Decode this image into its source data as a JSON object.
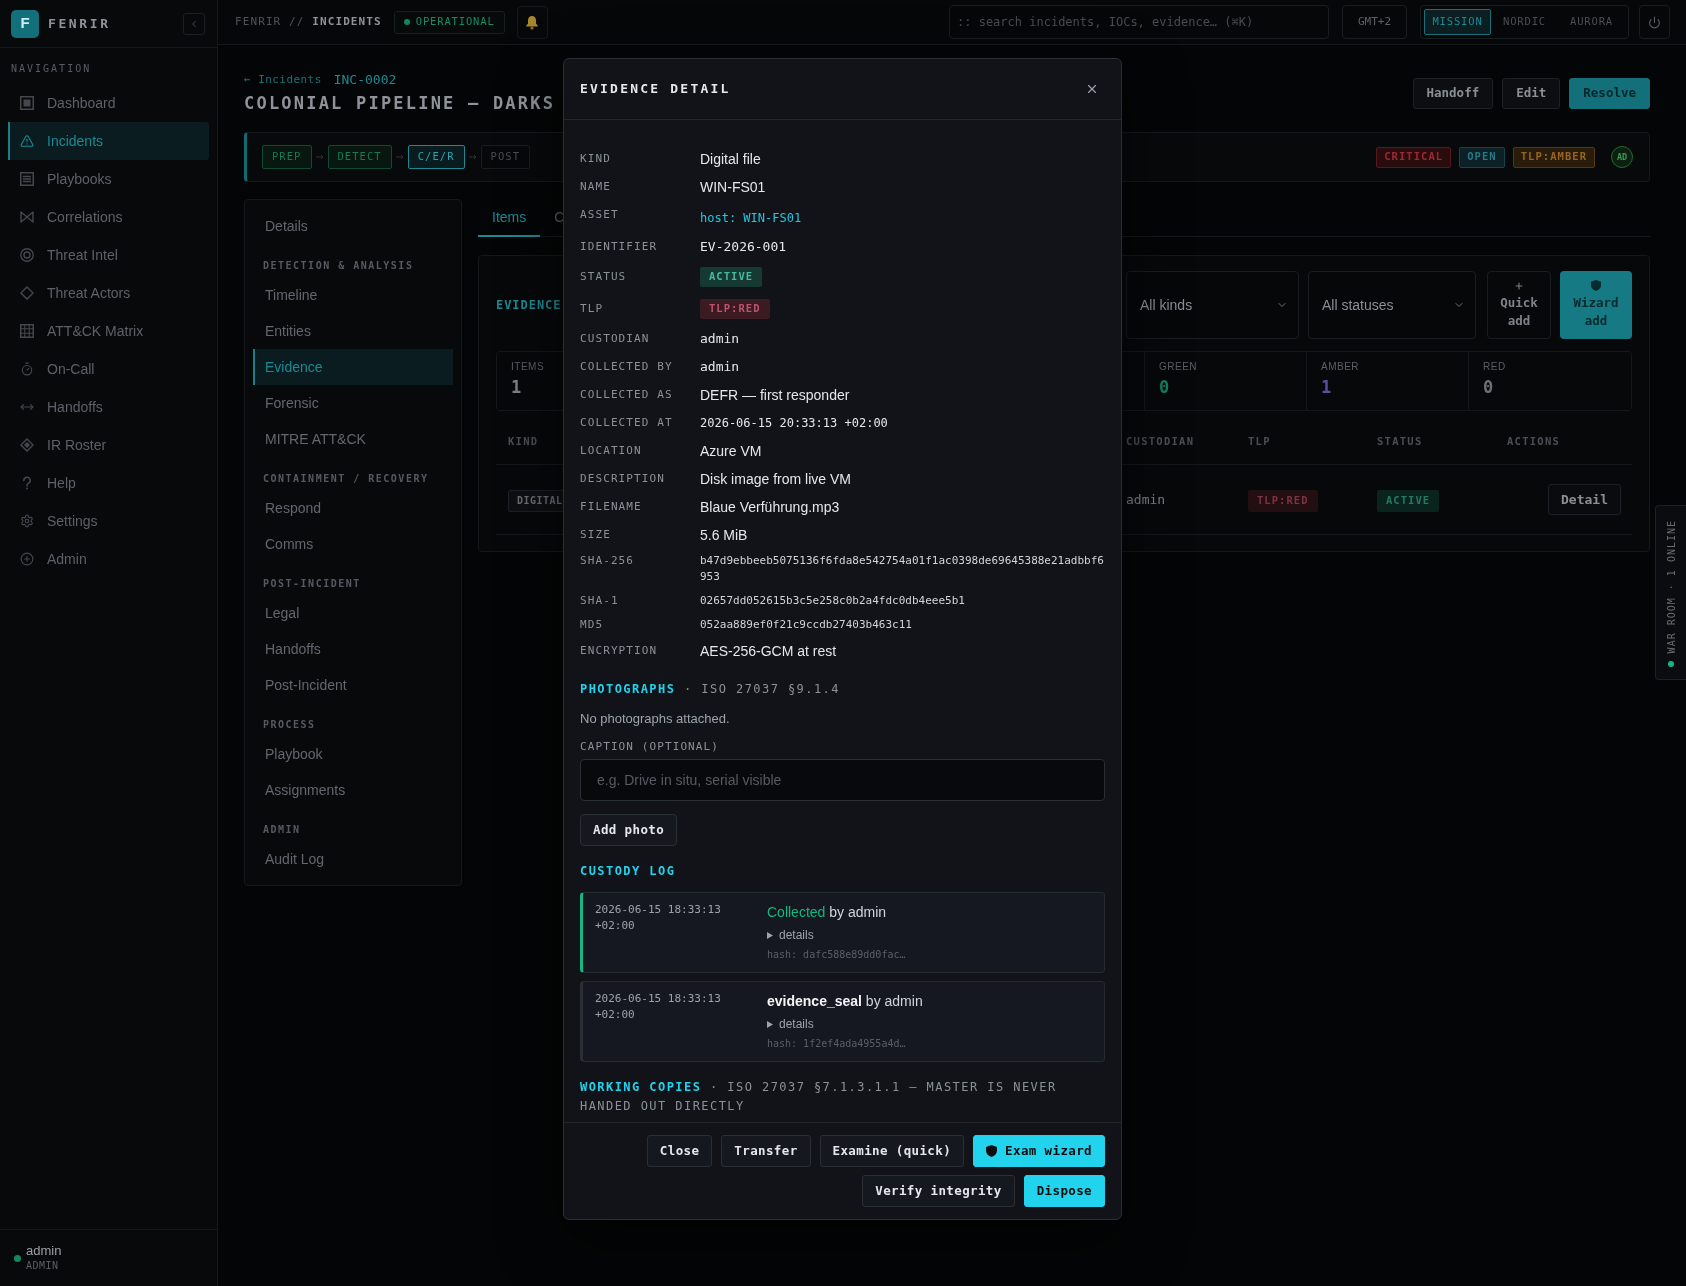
{
  "sidebar": {
    "logo": "F",
    "brand": "FENRIR",
    "heading": "NAVIGATION",
    "items": [
      {
        "label": "Dashboard",
        "selected": false
      },
      {
        "label": "Incidents",
        "selected": true
      },
      {
        "label": "Playbooks",
        "selected": false
      },
      {
        "label": "Correlations",
        "selected": false
      },
      {
        "label": "Threat Intel",
        "selected": false
      },
      {
        "label": "Threat Actors",
        "selected": false
      },
      {
        "label": "ATT&CK Matrix",
        "selected": false
      },
      {
        "label": "On-Call",
        "selected": false
      },
      {
        "label": "Handoffs",
        "selected": false
      },
      {
        "label": "IR Roster",
        "selected": false
      },
      {
        "label": "Help",
        "selected": false
      },
      {
        "label": "Settings",
        "selected": false
      },
      {
        "label": "Admin",
        "selected": false
      }
    ],
    "user": {
      "name": "admin",
      "role": "ADMIN",
      "online": true
    }
  },
  "topbar": {
    "breadcrumb": {
      "root": "FENRIR //",
      "current": "INCIDENTS"
    },
    "status": "OPERATIONAL",
    "search": {
      "placeholder": ":: search incidents, IOCs, evidence… (⌘K)"
    },
    "timezone": "GMT+2",
    "themes": [
      {
        "label": "MISSION",
        "selected": true
      },
      {
        "label": "NORDIC",
        "selected": false
      },
      {
        "label": "AURORA",
        "selected": false
      }
    ]
  },
  "incident": {
    "back_link": "← Incidents",
    "id": "INC-0002",
    "title": "COLONIAL PIPELINE — DARKS",
    "actions": [
      {
        "label": "Handoff",
        "kind": "secondary"
      },
      {
        "label": "Edit",
        "kind": "secondary"
      },
      {
        "label": "Resolve",
        "kind": "primary"
      }
    ],
    "stages": [
      {
        "label": "PREP",
        "done": true,
        "selected": false
      },
      {
        "label": "DETECT",
        "done": true,
        "selected": false
      },
      {
        "label": "C/E/R",
        "done": false,
        "selected": true
      },
      {
        "label": "POST",
        "done": false,
        "selected": false
      }
    ],
    "badges": [
      {
        "label": "CRITICAL",
        "color": "#2b0c0e"
      },
      {
        "label": "OPEN",
        "color": "#0c2126"
      },
      {
        "label": "TLP:AMBER",
        "color": "#2a1c0a"
      }
    ],
    "assignee": "AD"
  },
  "subnav": [
    {
      "items": [
        {
          "label": "Details",
          "selected": false
        }
      ]
    },
    {
      "title": "DETECTION & ANALYSIS",
      "items": [
        {
          "label": "Timeline",
          "selected": false
        },
        {
          "label": "Entities",
          "selected": false
        },
        {
          "label": "Evidence",
          "selected": true
        },
        {
          "label": "Forensic",
          "selected": false
        },
        {
          "label": "MITRE ATT&CK",
          "selected": false
        }
      ]
    },
    {
      "title": "CONTAINMENT / RECOVERY",
      "items": [
        {
          "label": "Respond",
          "selected": false
        },
        {
          "label": "Comms",
          "selected": false
        }
      ]
    },
    {
      "title": "POST-INCIDENT",
      "items": [
        {
          "label": "Legal",
          "selected": false
        },
        {
          "label": "Handoffs",
          "selected": false
        },
        {
          "label": "Post-Incident",
          "selected": false
        }
      ]
    },
    {
      "title": "PROCESS",
      "items": [
        {
          "label": "Playbook",
          "selected": false
        },
        {
          "label": "Assignments",
          "selected": false
        }
      ]
    },
    {
      "title": "ADMIN",
      "items": [
        {
          "label": "Audit Log",
          "selected": false
        }
      ]
    }
  ],
  "tabs": [
    {
      "label": "Items",
      "selected": true
    },
    {
      "label": "C",
      "selected": false
    }
  ],
  "evidence": {
    "title": "EVIDENCE",
    "filters": [
      {
        "value": "All kinds"
      },
      {
        "value": "All statuses"
      }
    ],
    "quick_add": "Quick add",
    "wizard_add": "Wizard add",
    "stats": [
      {
        "label": "ITEMS",
        "value": "1",
        "color": "#7d8288"
      },
      {
        "label": "GREEN",
        "value": "0",
        "color": "#13805d"
      },
      {
        "label": "AMBER",
        "value": "1",
        "color": "#5d4fa0"
      },
      {
        "label": "RED",
        "value": "0",
        "color": "#6d7177"
      }
    ],
    "columns": [
      "KIND",
      "CUSTODIAN",
      "TLP",
      "STATUS",
      "ACTIONS"
    ],
    "rows": [
      {
        "kind_label": "DIGITAL",
        "custodian": "admin",
        "tlp": "TLP:RED",
        "status": "ACTIVE",
        "action": "Detail"
      }
    ]
  },
  "war_room": {
    "label": "WAR ROOM · 1 ONLINE",
    "live": true
  },
  "modal": {
    "title": "EVIDENCE DETAIL",
    "fields": [
      {
        "label": "KIND",
        "value": "Digital file",
        "kind": "text"
      },
      {
        "label": "NAME",
        "value": "WIN-FS01",
        "kind": "text"
      },
      {
        "label": "ASSET",
        "value": "host: WIN-FS01",
        "kind": "link"
      },
      {
        "label": "IDENTIFIER",
        "value": "EV-2026-001",
        "kind": "mono"
      },
      {
        "label": "STATUS",
        "value": "ACTIVE",
        "kind": "badge",
        "color": "#163a32"
      },
      {
        "label": "TLP",
        "value": "TLP:RED",
        "kind": "badge",
        "color": "#3b1a22"
      },
      {
        "label": "CUSTODIAN",
        "value": "admin",
        "kind": "mono"
      },
      {
        "label": "COLLECTED BY",
        "value": "admin",
        "kind": "mono"
      },
      {
        "label": "COLLECTED AS",
        "value": "DEFR — first responder",
        "kind": "text"
      },
      {
        "label": "COLLECTED AT",
        "value": "2026-06-15 20:33:13 +02:00",
        "kind": "timestamp"
      },
      {
        "label": "LOCATION",
        "value": "Azure VM",
        "kind": "text"
      },
      {
        "label": "DESCRIPTION",
        "value": "Disk image from live VM",
        "kind": "text"
      },
      {
        "label": "FILENAME",
        "value": "Blaue Verführung.mp3",
        "kind": "text"
      },
      {
        "label": "SIZE",
        "value": "5.6 MiB",
        "kind": "text"
      },
      {
        "label": "SHA-256",
        "value": "b47d9ebbeeb5075136f6fda8e542754a01f1ac0398de69645388e21adbbf6953",
        "kind": "hash"
      },
      {
        "label": "SHA-1",
        "value": "02657dd052615b3c5e258c0b2a4fdc0db4eee5b1",
        "kind": "hash"
      },
      {
        "label": "MD5",
        "value": "052aa889ef0f21c9ccdb27403b463c11",
        "kind": "hash"
      },
      {
        "label": "ENCRYPTION",
        "value": "AES-256-GCM at rest",
        "kind": "text"
      }
    ],
    "photographs": {
      "title": "PHOTOGRAPHS",
      "subtitle": "· ISO 27037 §9.1.4",
      "empty_text": "No photographs attached.",
      "caption_label": "CAPTION (OPTIONAL)",
      "caption": {
        "placeholder": "e.g. Drive in situ, serial visible"
      },
      "add_button": "Add photo"
    },
    "custody_log": {
      "title": "CUSTODY LOG",
      "entries": [
        {
          "time": "2026-06-15 18:33:13 +02:00",
          "action": "Collected",
          "by": "by admin",
          "kind": "collected",
          "details": "details",
          "hash": "hash: dafc588e89dd0fac…"
        },
        {
          "time": "2026-06-15 18:33:13 +02:00",
          "action": "evidence_seal",
          "by": "by admin",
          "kind": "event",
          "details": "details",
          "hash": "hash: 1f2ef4ada4955a4d…"
        }
      ]
    },
    "working_copies": {
      "title": "WORKING COPIES",
      "subtitle": "· ISO 27037 §7.1.3.1.1 — MASTER IS NEVER HANDED OUT DIRECTLY"
    },
    "buttons": [
      {
        "label": "Close",
        "kind": "secondary"
      },
      {
        "label": "Transfer",
        "kind": "secondary"
      },
      {
        "label": "Examine (quick)",
        "kind": "secondary"
      },
      {
        "label": "Exam wizard",
        "kind": "wizard"
      },
      {
        "label": "Verify integrity",
        "kind": "secondary"
      },
      {
        "label": "Dispose",
        "kind": "primary"
      }
    ]
  }
}
